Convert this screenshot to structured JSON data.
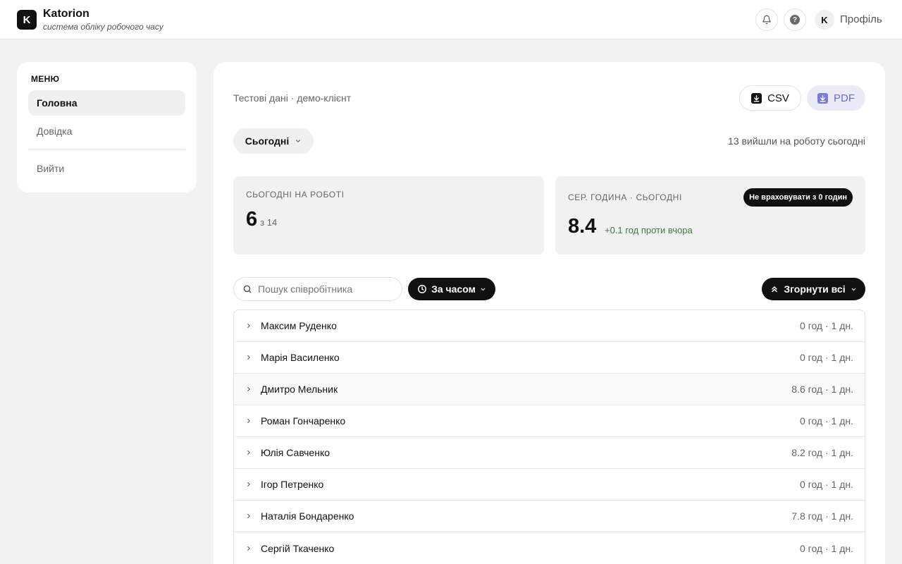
{
  "header": {
    "logo_letter": "K",
    "app_name": "Katorion",
    "tagline": "система обліку робочого часу",
    "avatar_letter": "K",
    "profile_label": "Профіль",
    "help_glyph": "?"
  },
  "sidebar": {
    "title": "МЕНЮ",
    "items": [
      {
        "label": "Головна"
      },
      {
        "label": "Довідка"
      },
      {
        "label": "Вийти"
      }
    ]
  },
  "main": {
    "test_label": "Тестові дані · демо-клієнт",
    "csv_label": "CSV",
    "pdf_label": "PDF",
    "period_label": "Сьогодні",
    "today_count": "13 вийшли на роботу сьогодні",
    "stat_at_work": {
      "label": "СЬОГОДНІ НА РОБОТІ",
      "value": "6",
      "sub": "з 14"
    },
    "stat_avg_hours": {
      "label": "СЕР. ГОДИНА · СЬОГОДНІ",
      "value": "8.4",
      "delta": "+0.1 год проти вчора",
      "badge": "Не враховувати з 0 годин"
    },
    "search_placeholder": "Пошук співробітника",
    "sort_label": "За часом",
    "collapse_label": "Згорнути всі",
    "employees": [
      {
        "name": "Максим Руденко",
        "stats": "0 год · 1 дн."
      },
      {
        "name": "Марія Василенко",
        "stats": "0 год · 1 дн."
      },
      {
        "name": "Дмитро Мельник",
        "stats": "8.6 год · 1 дн."
      },
      {
        "name": "Роман Гончаренко",
        "stats": "0 год · 1 дн."
      },
      {
        "name": "Юлія Савченко",
        "stats": "8.2 год · 1 дн."
      },
      {
        "name": "Ігор Петренко",
        "stats": "0 год · 1 дн."
      },
      {
        "name": "Наталія Бондаренко",
        "stats": "7.8 год · 1 дн."
      },
      {
        "name": "Сергій Ткаченко",
        "stats": "0 год · 1 дн."
      }
    ]
  },
  "colors": {
    "accent_dark": "#111111",
    "pdf_accent": "#6c6cd0",
    "delta_green": "#3d7a44"
  }
}
